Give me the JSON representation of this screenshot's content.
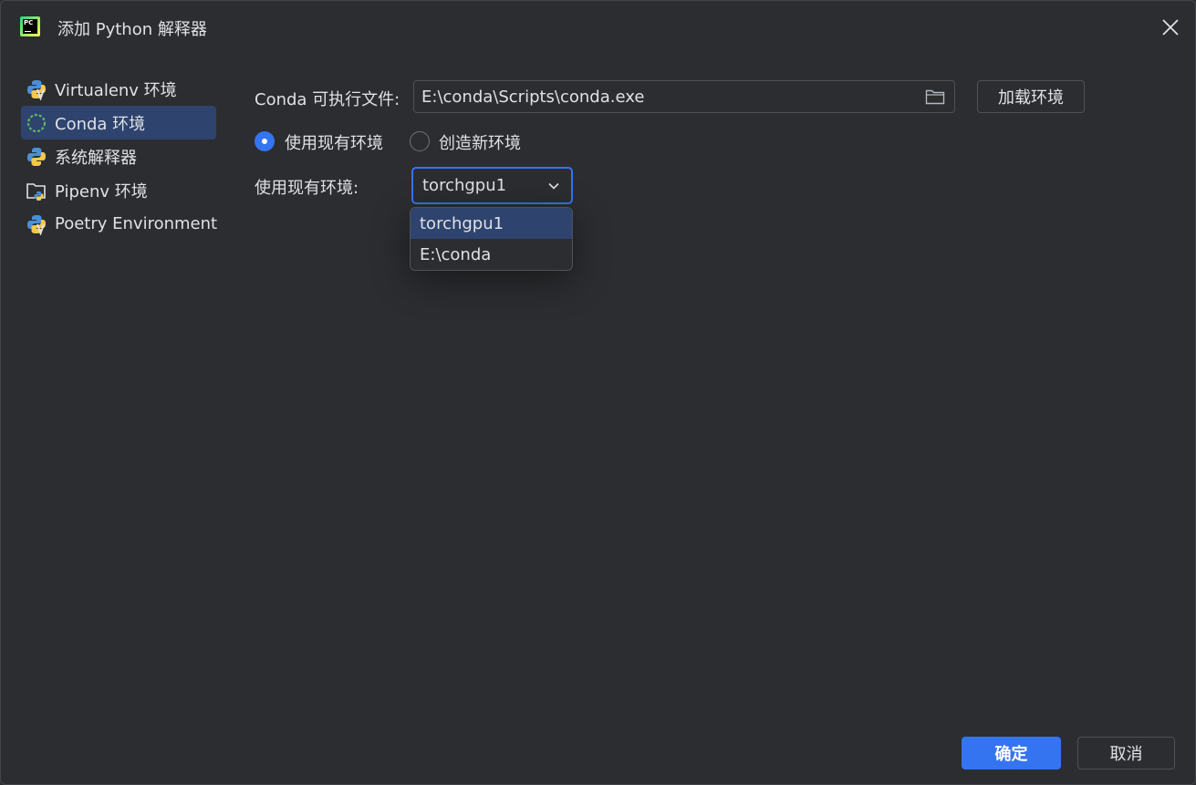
{
  "window": {
    "title": "添加 Python 解释器",
    "app_icon_text": "PC"
  },
  "sidebar": {
    "items": [
      {
        "label": "Virtualenv 环境",
        "icon": "python-virtualenv-icon",
        "selected": false
      },
      {
        "label": "Conda 环境",
        "icon": "conda-icon",
        "selected": true
      },
      {
        "label": "系统解释器",
        "icon": "python-icon",
        "selected": false
      },
      {
        "label": "Pipenv 环境",
        "icon": "pipenv-folder-icon",
        "selected": false
      },
      {
        "label": "Poetry Environment",
        "icon": "poetry-icon",
        "selected": false
      }
    ]
  },
  "conda": {
    "executable_label": "Conda 可执行文件:",
    "executable_value": "E:\\conda\\Scripts\\conda.exe",
    "load_button": "加载环境",
    "radio_existing": "使用现有环境",
    "radio_new": "创造新环境",
    "existing_label": "使用现有环境:",
    "selected_env": "torchgpu1",
    "env_options": [
      "torchgpu1",
      "E:\\conda"
    ]
  },
  "footer": {
    "ok": "确定",
    "cancel": "取消"
  },
  "colors": {
    "background": "#2b2d30",
    "accent": "#3574f0",
    "selection": "#2e436e"
  }
}
